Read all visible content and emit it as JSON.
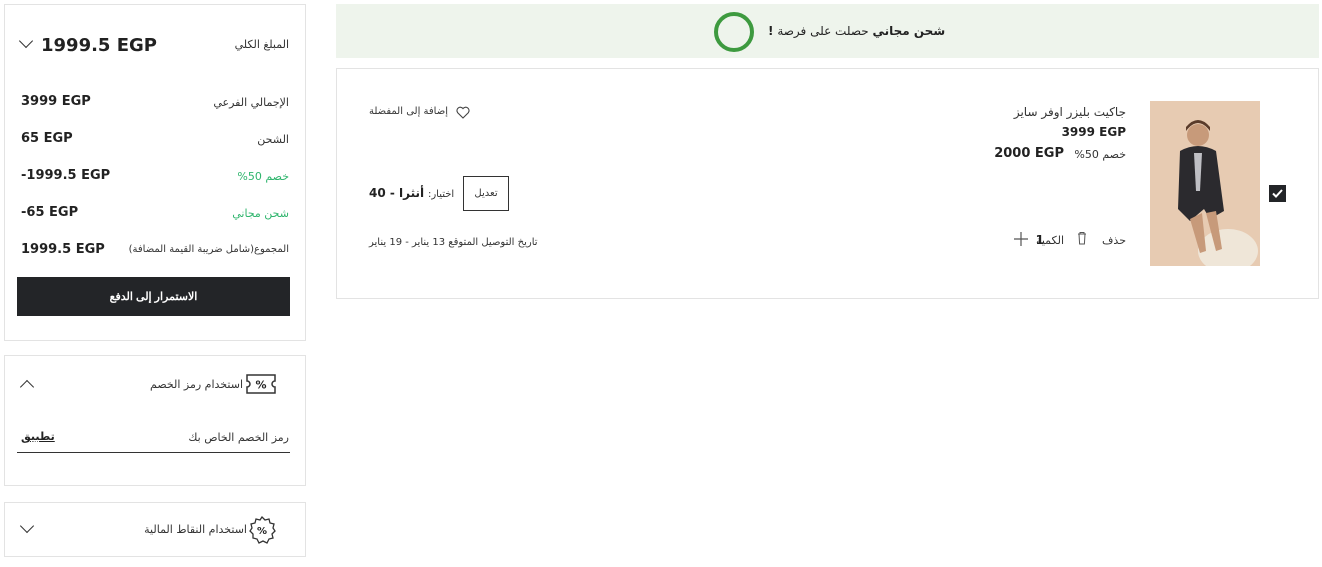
{
  "summary": {
    "total_label": "المبلغ الكلي",
    "total_value": "1999.5 EGP",
    "rows": [
      {
        "label": "الإجمالي الفرعي",
        "value": "3999 EGP"
      },
      {
        "label": "الشحن",
        "value": "65 EGP"
      },
      {
        "label": "خصم 50%",
        "value": "-1999.5 EGP"
      },
      {
        "label": "شحن مجاني",
        "value": "-65 EGP"
      },
      {
        "label": "المجموع(شامل ضريبة القيمة المضافة)",
        "value": "1999.5 EGP"
      }
    ],
    "checkout_label": "الاستمرار إلى الدفع"
  },
  "coupon": {
    "title": "استخدام رمز الخصم",
    "input_placeholder": "رمز الخصم الخاص بك",
    "apply_label": "تطبيق"
  },
  "points": {
    "title": "استخدام النقاط المالية"
  },
  "banner": {
    "bold_text": "شحن مجاني",
    "text": "حصلت على فرصة",
    "exclaim": "!"
  },
  "item": {
    "name": "جاكيت بليزر اوفر سايز",
    "price": "3999 EGP",
    "discount_label": "خصم 50%",
    "discounted_price": "2000 EGP",
    "wishlist_label": "إضافة إلى المفضلة",
    "selection_label": "اختيار:",
    "selection_value": "أنثرا - 40",
    "edit_label": "تعديل",
    "delete_label": "حذف",
    "quantity_label": "الكمية",
    "quantity_value": "1",
    "delivery_label": "تاريخ التوصيل المتوقع",
    "delivery_value": "13 يناير - 19 يناير"
  },
  "colors": {
    "accent_green": "#2fb56d",
    "banner_bg": "#eef4ec",
    "ring_green": "#3d9a3f",
    "button_dark": "#232528"
  }
}
